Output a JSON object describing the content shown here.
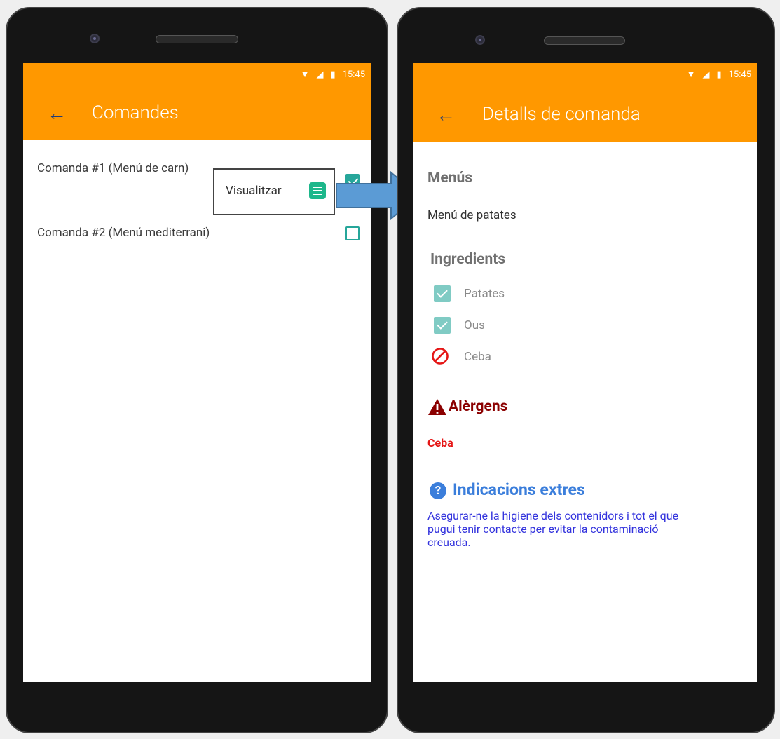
{
  "status_bar": {
    "time": "15:45"
  },
  "screen_orders": {
    "title": "Comandes",
    "back_icon": "←",
    "orders": [
      {
        "label": "Comanda #1 (Menú de carn)",
        "checked": true
      },
      {
        "label": "Comanda #2 (Menú mediterrani)",
        "checked": false
      }
    ],
    "popup": {
      "label": "Visualitzar",
      "icon": "list-icon"
    }
  },
  "screen_details": {
    "title": "Detalls de comanda",
    "back_icon": "←",
    "menus_heading": "Menús",
    "menu_item": "Menú de patates",
    "ingredients_heading": "Ingredients",
    "ingredients": [
      {
        "label": "Patates",
        "state": "checked"
      },
      {
        "label": "Ous",
        "state": "checked"
      },
      {
        "label": "Ceba",
        "state": "excluded"
      }
    ],
    "allergens_heading": "Alèrgens",
    "allergen_item": "Ceba",
    "extras_heading": "Indicacions extres",
    "extras_text": "Asegurar-ne la higiene dels contenidors i tot el que pugui tenir contacte per evitar la contaminació creuada."
  },
  "colors": {
    "app_bar": "#FF9800",
    "checkbox": "#26A69A",
    "ingredient_checkbox": "#80CBC4",
    "allergen_heading": "#8B0000",
    "allergen_item": "#E51616",
    "extras": "#3B7EDB",
    "arrow": "#5B9BD5"
  }
}
